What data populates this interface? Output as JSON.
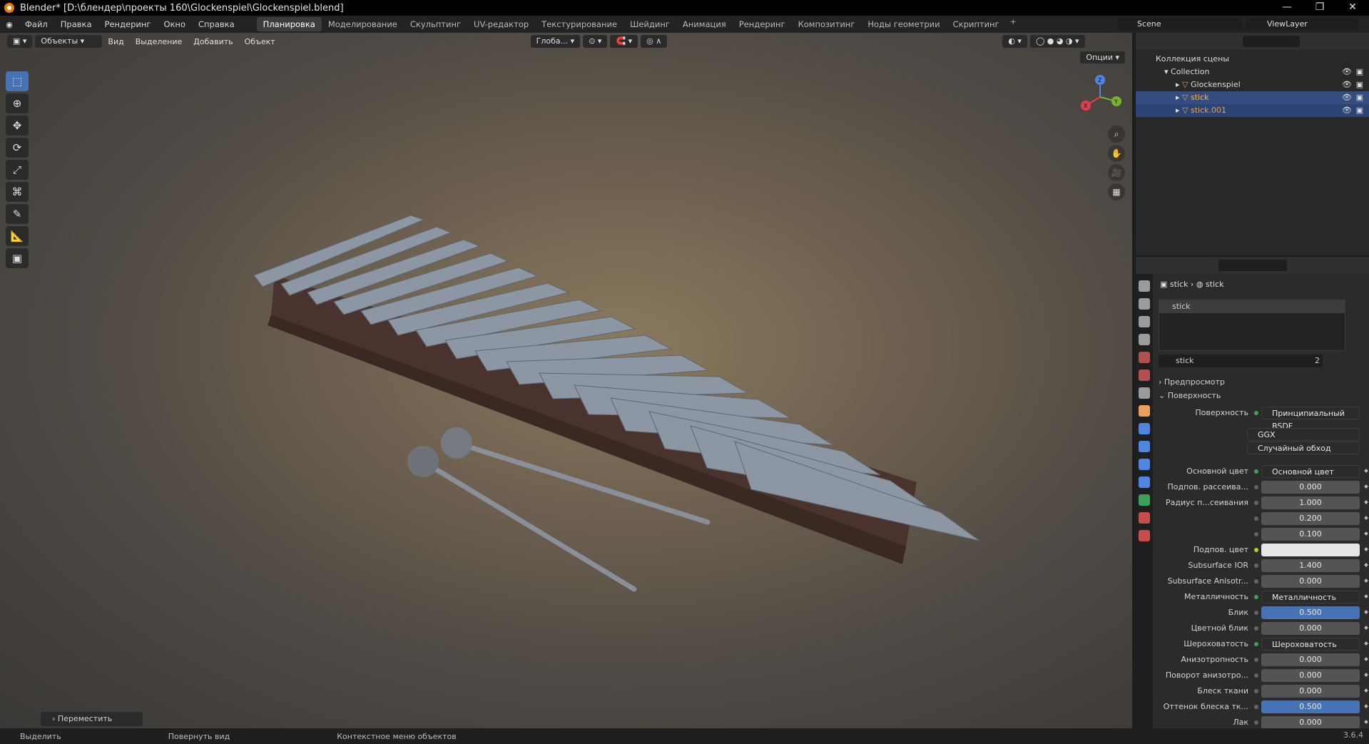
{
  "window": {
    "title": "Blender* [D:\\блендер\\проекты 160\\Glockenspiel\\Glockenspiel.blend]",
    "controls": [
      "—",
      "❐",
      "✕"
    ]
  },
  "menu": [
    "Файл",
    "Правка",
    "Рендеринг",
    "Окно",
    "Справка"
  ],
  "workspaces": [
    "Планировка",
    "Моделирование",
    "Скульптинг",
    "UV-редактор",
    "Текстурирование",
    "Шейдинг",
    "Анимация",
    "Рендеринг",
    "Композитинг",
    "Ноды геометрии",
    "Скриптинг"
  ],
  "workspace_add": "+",
  "scene": "Scene",
  "view_layer": "ViewLayer",
  "viewport": {
    "mode": "Объекты",
    "menus": [
      "Вид",
      "Выделение",
      "Добавить",
      "Объект"
    ],
    "orientation": "Глоба...",
    "options_label": "Опции",
    "last_operator": "Переместить",
    "gizmo": {
      "x": "X",
      "y": "Y",
      "z": "Z"
    }
  },
  "outliner": {
    "scene_collection": "Коллекция сцены",
    "collection": "Collection",
    "items": [
      "Glockenspiel",
      "stick",
      "stick.001"
    ]
  },
  "properties": {
    "breadcrumb": [
      "stick",
      "stick"
    ],
    "slot": "stick",
    "material_name": "stick",
    "users": "2",
    "panels": {
      "preview": "Предпросмотр",
      "surface": "Поверхность"
    },
    "surface_label": "Поверхность",
    "surface_value": "Принципиальный BSDF",
    "distribution": "GGX",
    "subsurface_method": "Случайный обход",
    "rows": [
      {
        "label": "Основной цвет",
        "value": "Основной цвет",
        "kind": "link"
      },
      {
        "label": "Подпов. рассеива...",
        "value": "0.000",
        "kind": "num"
      },
      {
        "label": "Радиус п...сеивания",
        "value": "1.000",
        "kind": "num"
      },
      {
        "label": "",
        "value": "0.200",
        "kind": "num"
      },
      {
        "label": "",
        "value": "0.100",
        "kind": "num"
      },
      {
        "label": "Подпов. цвет",
        "value": "",
        "kind": "color"
      },
      {
        "label": "Subsurface IOR",
        "value": "1.400",
        "kind": "num"
      },
      {
        "label": "Subsurface Anisotr...",
        "value": "0.000",
        "kind": "num"
      },
      {
        "label": "Металличность",
        "value": "Металличность",
        "kind": "link"
      },
      {
        "label": "Блик",
        "value": "0.500",
        "kind": "blue"
      },
      {
        "label": "Цветной блик",
        "value": "0.000",
        "kind": "num"
      },
      {
        "label": "Шероховатость",
        "value": "Шероховатость",
        "kind": "link"
      },
      {
        "label": "Анизотропность",
        "value": "0.000",
        "kind": "num"
      },
      {
        "label": "Поворот анизотро...",
        "value": "0.000",
        "kind": "num"
      },
      {
        "label": "Блеск ткани",
        "value": "0.000",
        "kind": "num"
      },
      {
        "label": "Оттенок блеска тк...",
        "value": "0.500",
        "kind": "blue"
      },
      {
        "label": "Лак",
        "value": "0.000",
        "kind": "num"
      }
    ]
  },
  "status": {
    "select": "Выделить",
    "rotate": "Повернуть вид",
    "context": "Контекстное меню объектов",
    "version": "3.6.4"
  }
}
